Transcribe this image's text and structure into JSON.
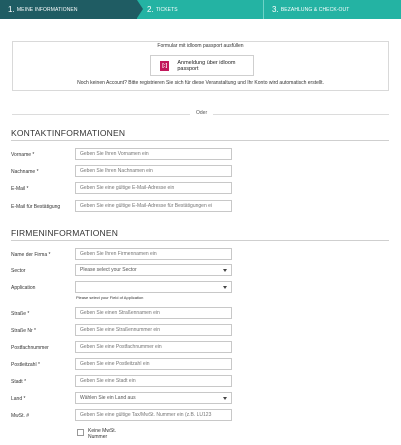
{
  "steps": [
    {
      "num": "1.",
      "label": "MEINE INFORMATIONEN"
    },
    {
      "num": "2.",
      "label": "TICKETS"
    },
    {
      "num": "3.",
      "label": "BEZAHLUNG & CHECK-OUT"
    }
  ],
  "passport": {
    "title": "Formular mit idloom passport ausfüllen",
    "button_label": "Anmeldung über idloom passport",
    "logo_text": "[:]",
    "note": "Noch keinen Account? Bitte registrieren Sie sich für diese Veranstaltung und Ihr Konto wird automatisch erstellt."
  },
  "divider_label": "Oder",
  "contact": {
    "title": "KONTAKTINFORMATIONEN",
    "fields": [
      {
        "label": "Vorname *",
        "placeholder": "Geben Sie Ihren Vornamen ein"
      },
      {
        "label": "Nachname *",
        "placeholder": "Geben Sie Ihren Nachnamen ein"
      },
      {
        "label": "E-Mail *",
        "placeholder": "Geben Sie eine gültige E-Mail-Adresse ein"
      },
      {
        "label": "E-Mail für Bestätigung",
        "placeholder": "Geben Sie eine gültige E-Mail-Adresse für Bestätigungen ei"
      }
    ]
  },
  "company": {
    "title": "FIRMENINFORMATIONEN",
    "fields": [
      {
        "label": "Name der Firma *",
        "placeholder": "Geben Sie Ihren Firmennamen ein"
      },
      {
        "label": "Sector",
        "value": "Please select your Sector"
      },
      {
        "label": "Application",
        "value": ""
      },
      {
        "label": "Straße *",
        "placeholder": "Geben Sie einen Straßennamen ein"
      },
      {
        "label": "Straße Nr *",
        "placeholder": "Geben Sie eine Straßennummer ein"
      },
      {
        "label": "Postfachnummer",
        "placeholder": "Geben Sie eine Postfachnummer ein"
      },
      {
        "label": "Postleitzahl *",
        "placeholder": "Geben Sie eine Postleitzahl ein"
      },
      {
        "label": "Stadt *",
        "placeholder": "Geben Sie eine Stadt ein"
      },
      {
        "label": "Land *",
        "value": "Wählen Sie ein Land aus"
      },
      {
        "label": "MwSt. #",
        "placeholder": "Geben Sie eine gültige Tax/MwSt. Nummer ein (z.B. LU123"
      }
    ],
    "application_help": "Please select your Field of Application",
    "no_vat_label": "Keine MwSt. Nummer"
  }
}
